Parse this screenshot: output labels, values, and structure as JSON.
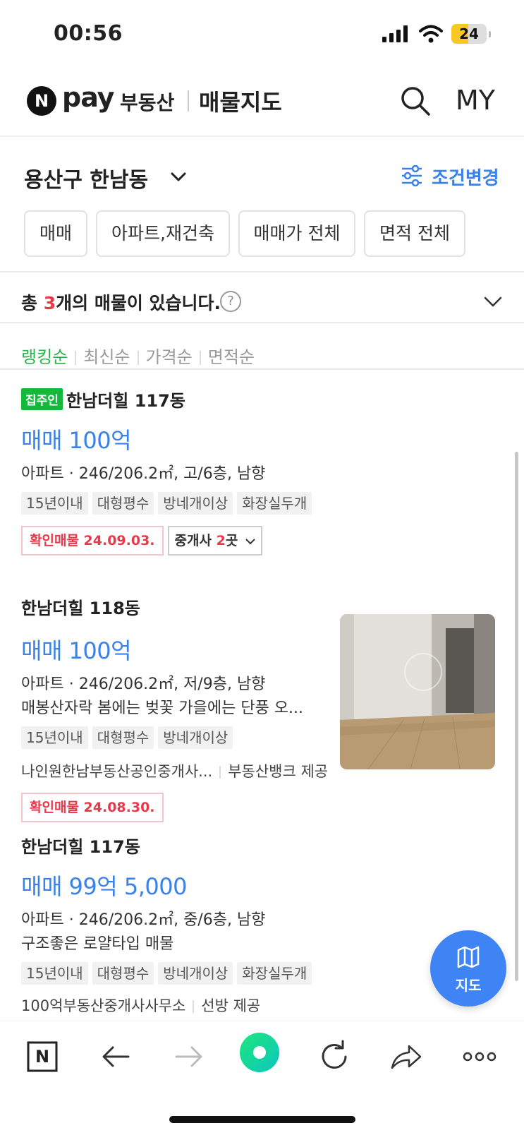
{
  "status_bar": {
    "time": "00:56",
    "battery": "24",
    "battery_level": 0.24
  },
  "header": {
    "logo_n": "N",
    "logo_pay": "pay",
    "logo_service": "부동산",
    "title": "매물지도",
    "my_label": "MY"
  },
  "location": {
    "label": "용산구 한남동",
    "condition_label": "조건변경"
  },
  "filters": [
    "매매",
    "아파트,재건축",
    "매매가 전체",
    "면적 전체"
  ],
  "summary": {
    "prefix": "총",
    "count": "3",
    "suffix": "개의 매물이 있습니다.",
    "help": "?"
  },
  "sort": [
    "랭킹순",
    "최신순",
    "가격순",
    "면적순"
  ],
  "listings": [
    {
      "owner_badge": "집주인",
      "name": "한남더힐 117동",
      "price": "매매 100억",
      "desc": "아파트 · 246/206.2㎡, 고/6층, 남향",
      "tags": [
        "15년이내",
        "대형평수",
        "방네개이상",
        "화장실두개"
      ],
      "verified": "확인매물 24.09.03.",
      "agent_prefix": "중개사",
      "agent_count": "2",
      "agent_suffix": "곳"
    },
    {
      "name": "한남더힐 118동",
      "price": "매매 100억",
      "desc": "아파트 · 246/206.2㎡, 저/9층, 남향",
      "feature": "매봉산자락 봄에는 벚꽃 가을에는 단풍 오...",
      "tags": [
        "15년이내",
        "대형평수",
        "방네개이상"
      ],
      "source_agent": "나인원한남부동산공인중개사...",
      "source_provider": "부동산뱅크 제공",
      "verified": "확인매물 24.08.30."
    },
    {
      "name": "한남더힐 117동",
      "price": "매매 99억 5,000",
      "desc": "아파트 · 246/206.2㎡, 중/6층, 남향",
      "feature": "구조좋은 로얄타입 매물",
      "tags": [
        "15년이내",
        "대형평수",
        "방네개이상",
        "화장실두개"
      ],
      "source_agent": "100억부동산중개사사무소",
      "source_provider": "선방 제공"
    }
  ],
  "fab": {
    "label": "지도"
  },
  "toolbar": {
    "n_label": "N"
  },
  "colors": {
    "accent_blue": "#3b82e8",
    "green": "#13b93b",
    "red": "#e8394a"
  }
}
